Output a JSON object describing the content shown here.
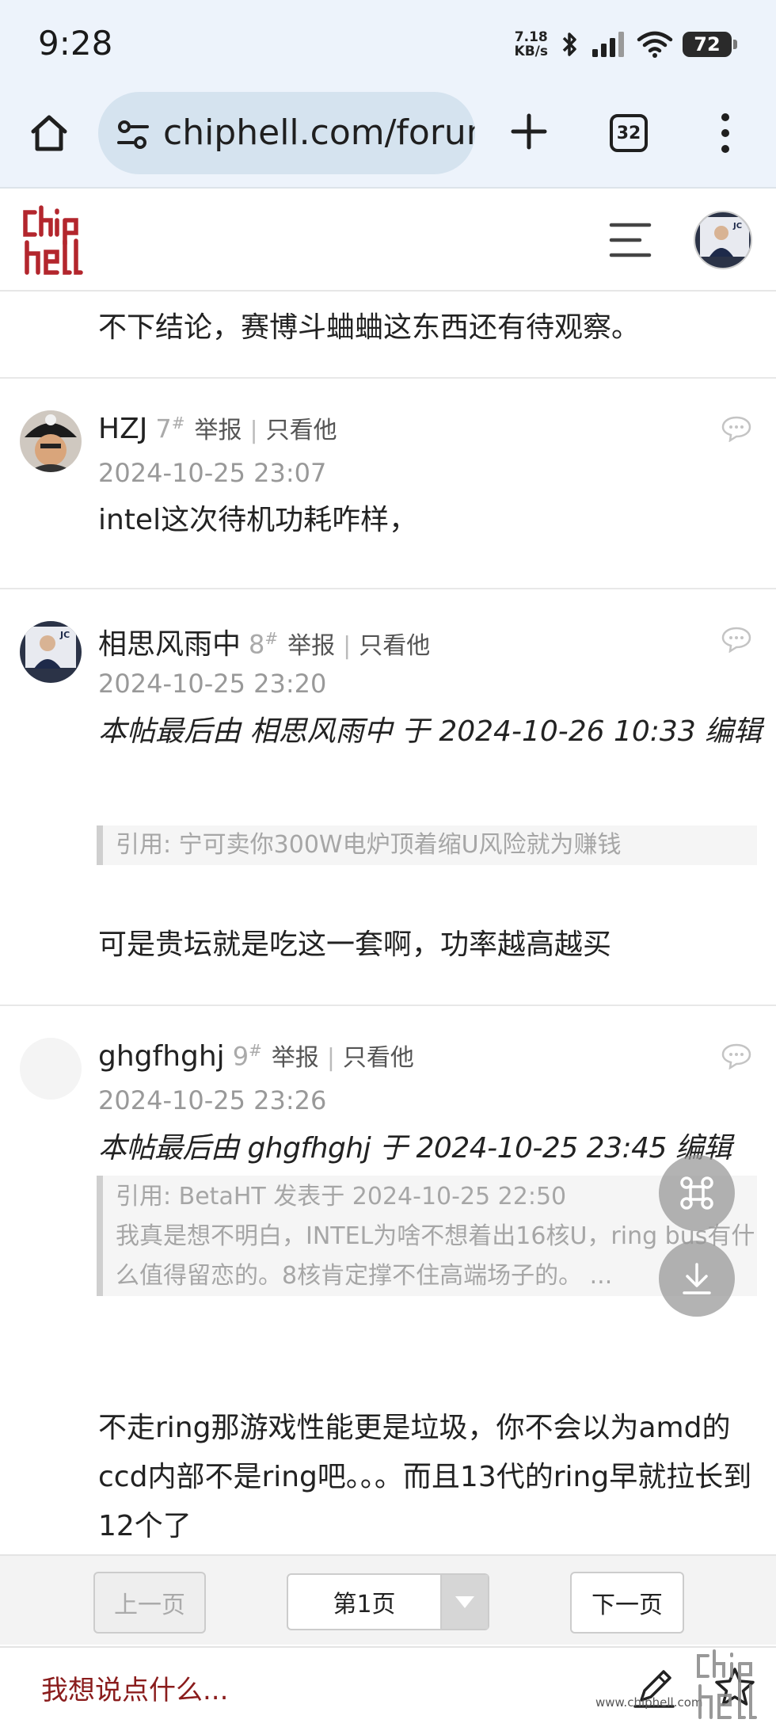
{
  "status_bar": {
    "time": "9:28",
    "net_speed_value": "7.18",
    "net_speed_unit": "KB/s",
    "battery": "72"
  },
  "browser": {
    "url": "chiphell.com/forum",
    "tab_count": "32"
  },
  "posts": {
    "previous_tail": "不下结论，赛博斗蛐蛐这东西还有待观察。",
    "p7": {
      "author": "HZJ",
      "floor": "7",
      "report": "举报",
      "only_him": "只看他",
      "date": "2024-10-25 23:07",
      "body": "intel这次待机功耗咋样，"
    },
    "p8": {
      "author": "相思风雨中",
      "floor": "8",
      "report": "举报",
      "only_him": "只看他",
      "date": "2024-10-25 23:20",
      "edit_note": "本帖最后由 相思风雨中 于 2024-10-26 10:33 编辑",
      "quote": "引用: 宁可卖你300W电炉顶着缩U风险就为赚钱",
      "body": "可是贵坛就是吃这一套啊，功率越高越买"
    },
    "p9": {
      "author": "ghgfhghj",
      "floor": "9",
      "report": "举报",
      "only_him": "只看他",
      "date": "2024-10-25 23:26",
      "edit_note": "本帖最后由 ghgfhghj 于 2024-10-25 23:45 编辑",
      "quote_header": "引用: BetaHT 发表于 2024-10-25 22:50",
      "quote_text": "我真是想不明白，INTEL为啥不想着出16核U，ring bus有什么值得留恋的。8核肯定撑不住高端场子的。 ...",
      "body": "不走ring那游戏性能更是垃圾，你不会以为amd的ccd内部不是ring吧。。。而且13代的ring早就拉长到12个了"
    }
  },
  "pagination": {
    "prev": "上一页",
    "current": "第1页",
    "next": "下一页"
  },
  "bottom_bar": {
    "reply_prompt": "我想说点什么...",
    "watermark": "www.chiphell.com"
  },
  "colors": {
    "browser_chrome": "#edf3fb",
    "url_pill": "#d5e3ef",
    "brand_red": "#b3262d",
    "reply_prompt": "#8a1c1c"
  }
}
